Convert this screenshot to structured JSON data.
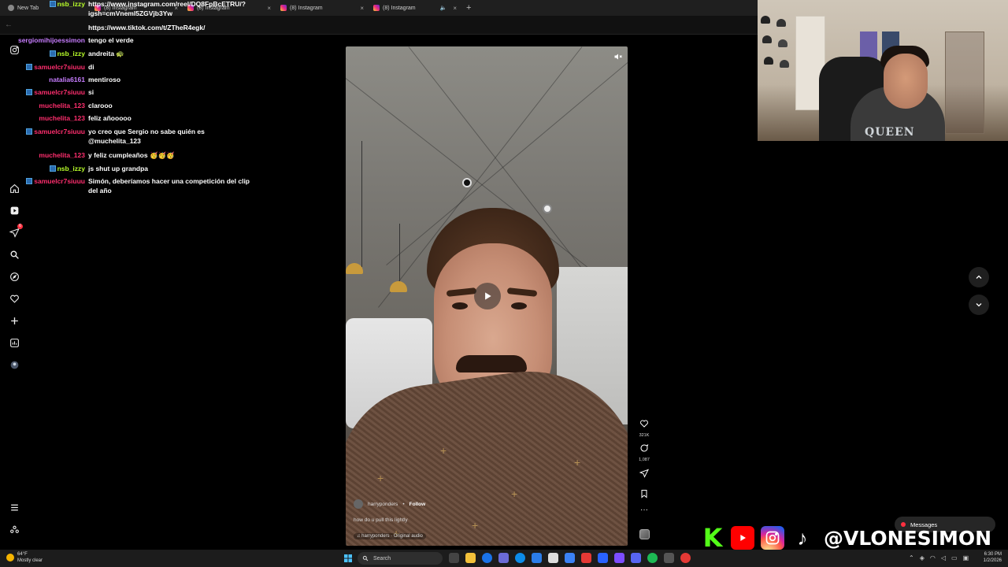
{
  "browser": {
    "tabs": [
      {
        "label": "New Tab"
      },
      {
        "label": "(8) Instagram"
      },
      {
        "label": "(8) Instagram"
      },
      {
        "label": "(8) Instagram"
      },
      {
        "label": "(8) Instagram"
      }
    ],
    "new_tab_symbol": "+",
    "close_symbol": "×"
  },
  "chat": {
    "messages": [
      {
        "user": "nsb_izzy",
        "text": "https://www.instagram.com/reel/DQ8FpBcETRU/?igsh=cmVneml5ZGVjb3Yw",
        "color": "#b9ff2a",
        "badge": true
      },
      {
        "user": "",
        "text": "https://www.tiktok.com/t/ZTheR4egk/",
        "color": "#ff2e6e",
        "badge": false
      },
      {
        "user": "sergiomihijoessimon",
        "text": "tengo el verde",
        "color": "#c77dff",
        "badge": false
      },
      {
        "user": "nsb_izzy",
        "text": "andreita 🐢",
        "color": "#b9ff2a",
        "badge": true
      },
      {
        "user": "samuelcr7siuuu",
        "text": "di",
        "color": "#ff2e6e",
        "badge": true
      },
      {
        "user": "natalia6161",
        "text": "mentiroso",
        "color": "#c77dff",
        "badge": false
      },
      {
        "user": "samuelcr7siuuu",
        "text": "si",
        "color": "#ff2e6e",
        "badge": true
      },
      {
        "user": "muchelita_123",
        "text": "clarooo",
        "color": "#ff2e6e",
        "badge": false
      },
      {
        "user": "muchelita_123",
        "text": "feliz añooooo",
        "color": "#ff2e6e",
        "badge": false
      },
      {
        "user": "samuelcr7siuuu",
        "text": "yo creo que Sergio no sabe quién es @muchelita_123",
        "color": "#ff2e6e",
        "badge": true
      },
      {
        "user": "muchelita_123",
        "text": "y feliz cumpleaños 🥳🥳🥳",
        "color": "#ff2e6e",
        "badge": false
      },
      {
        "user": "nsb_izzy",
        "text": "js shut up grandpa",
        "color": "#b9ff2a",
        "badge": true
      },
      {
        "user": "samuelcr7siuuu",
        "text": "Simón, deberíamos hacer una competición del clip del año",
        "color": "#ff2e6e",
        "badge": true
      }
    ]
  },
  "sidebar": {
    "items": [
      {
        "icon": "instagram-logo-icon"
      },
      {
        "icon": "home-icon"
      },
      {
        "icon": "reels-icon"
      },
      {
        "icon": "direct-messages-icon",
        "badge": "6"
      },
      {
        "icon": "search-icon"
      },
      {
        "icon": "explore-icon"
      },
      {
        "icon": "notifications-heart-icon"
      },
      {
        "icon": "create-plus-icon"
      },
      {
        "icon": "dashboard-icon"
      },
      {
        "icon": "profile-avatar-icon"
      },
      {
        "icon": "more-menu-icon"
      },
      {
        "icon": "also-from-meta-icon"
      }
    ]
  },
  "reel": {
    "author": "harryponders",
    "follow_label": "Follow",
    "caption": "how do u pull this lightly",
    "audio": "harryponders · Original audio",
    "likes": "321K",
    "comments": "1,087"
  },
  "messages_pill": {
    "label": "Messages"
  },
  "overlay": {
    "handle": "@VLONESIMON",
    "webcam_shirt_text": "QUEEN"
  },
  "taskbar": {
    "weather_temp": "64°F",
    "weather_desc": "Mostly clear",
    "search_placeholder": "Search",
    "time": "6:30 PM",
    "date": "1/2/2026"
  },
  "colors": {
    "instagram_badge": "#ff3040",
    "youtube_red": "#ff0000",
    "kick_green": "#53fc18"
  }
}
